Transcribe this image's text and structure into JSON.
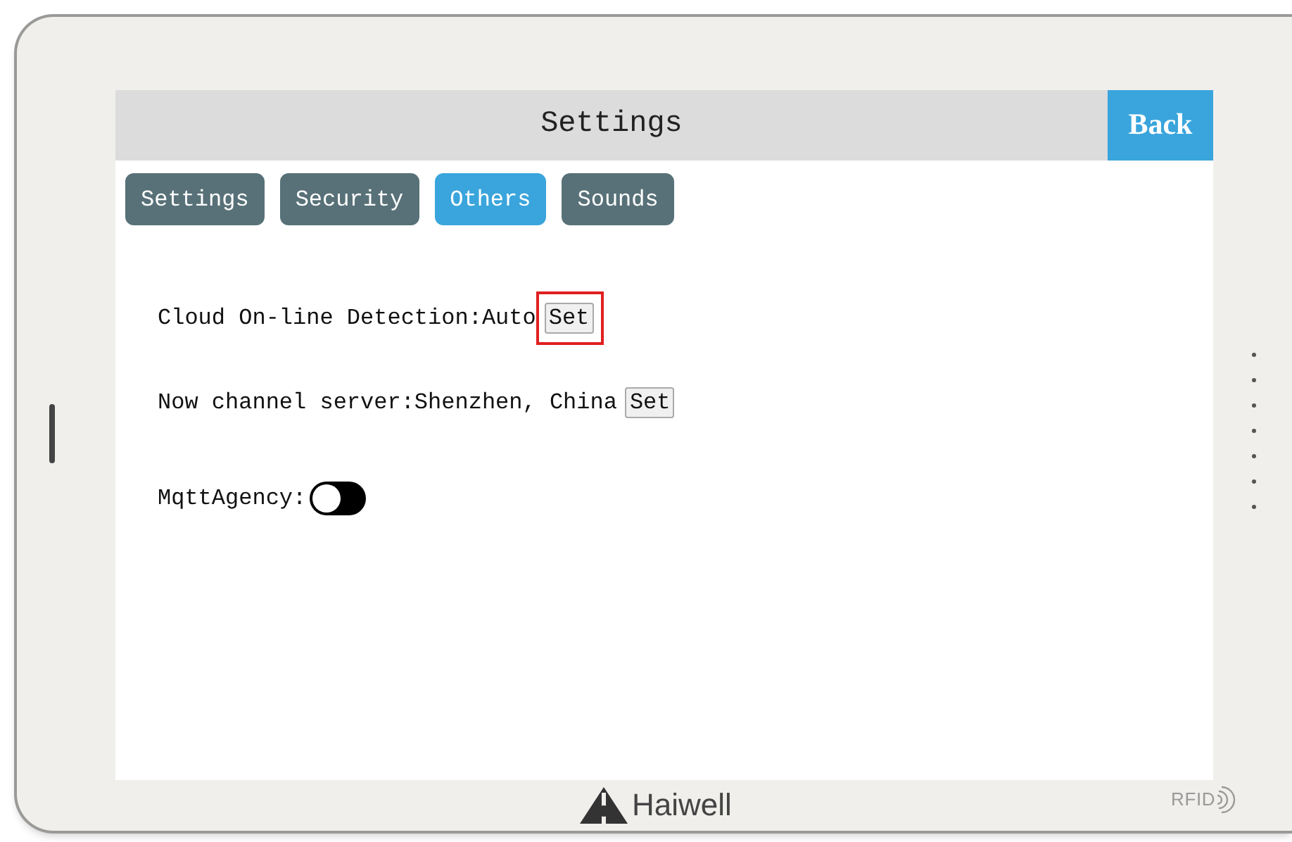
{
  "window": {
    "title": "Settings"
  },
  "back_button": "Back",
  "tabs": [
    {
      "label": "Settings",
      "selected": false
    },
    {
      "label": "Security",
      "selected": false
    },
    {
      "label": "Others",
      "selected": true
    },
    {
      "label": "Sounds",
      "selected": false
    }
  ],
  "rows": [
    {
      "kind": "setting",
      "label": "Cloud On-line Detection:Auto",
      "button": "Set",
      "highlighted": true
    },
    {
      "kind": "setting",
      "label": "Now channel server:Shenzhen, China",
      "button": "Set",
      "highlighted": false
    },
    {
      "kind": "toggle",
      "label": "MqttAgency:",
      "on": false
    }
  ],
  "bezel": {
    "brand": "Haiwell",
    "badge": "RFID"
  }
}
